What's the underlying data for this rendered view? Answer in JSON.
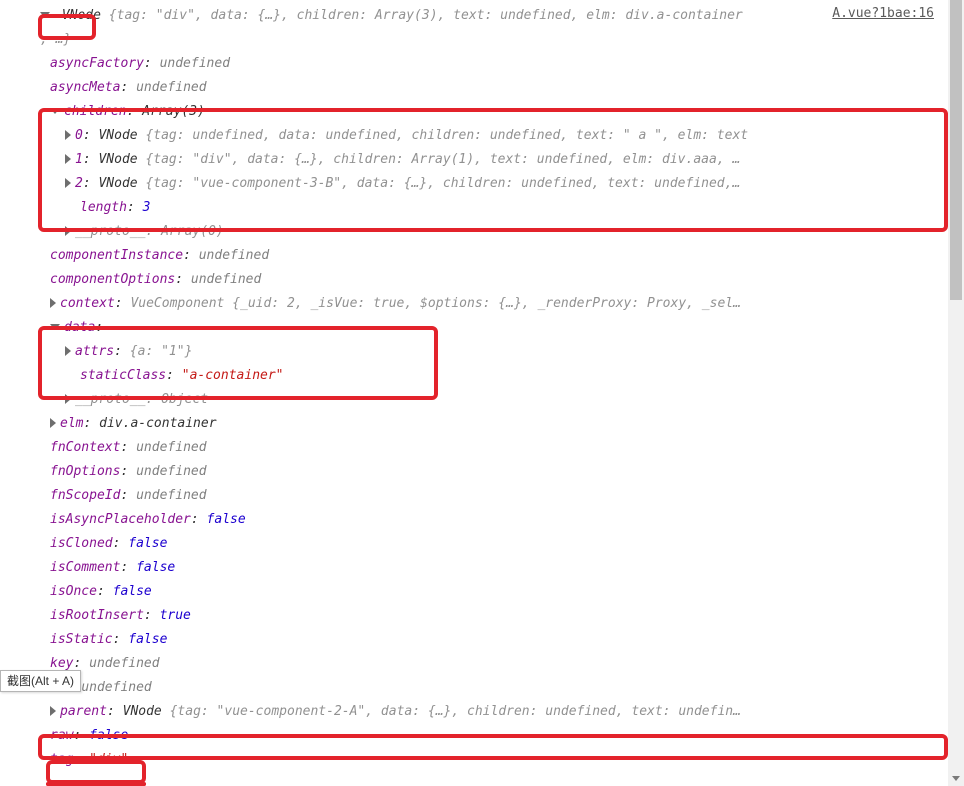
{
  "source_link": "A.vue?1bae:16",
  "tooltip": "截图(Alt + A)",
  "root": {
    "type": "VNode",
    "summary_open": "{",
    "summary_props": "tag: \"div\", data: {…}, children: Array(3), text: undefined, elm: div.a-container",
    "summary_close": ", …}"
  },
  "props": {
    "asyncFactory": {
      "k": "asyncFactory",
      "v": "undefined"
    },
    "asyncMeta": {
      "k": "asyncMeta",
      "v": "undefined"
    },
    "children": {
      "k": "children",
      "v": "Array(3)",
      "items": [
        {
          "idx": "0",
          "type": "VNode",
          "summary": "{tag: undefined, data: undefined, children: undefined, text: \" a \", elm: text"
        },
        {
          "idx": "1",
          "type": "VNode",
          "summary": "{tag: \"div\", data: {…}, children: Array(1), text: undefined, elm: div.aaa, …"
        },
        {
          "idx": "2",
          "type": "VNode",
          "summary": "{tag: \"vue-component-3-B\", data: {…}, children: undefined, text: undefined,…"
        }
      ],
      "length_k": "length",
      "length_v": "3",
      "proto_k": "__proto__",
      "proto_v": "Array(0)"
    },
    "componentInstance": {
      "k": "componentInstance",
      "v": "undefined"
    },
    "componentOptions": {
      "k": "componentOptions",
      "v": "undefined"
    },
    "context": {
      "k": "context",
      "v": "VueComponent {_uid: 2, _isVue: true, $options: {…}, _renderProxy: Proxy, _sel…"
    },
    "data": {
      "k": "data",
      "attrs_k": "attrs",
      "attrs_v": "{a: \"1\"}",
      "staticClass_k": "staticClass",
      "staticClass_v": "\"a-container\"",
      "proto_k": "__proto__",
      "proto_v": "Object"
    },
    "elm": {
      "k": "elm",
      "v": "div.a-container"
    },
    "fnContext": {
      "k": "fnContext",
      "v": "undefined"
    },
    "fnOptions": {
      "k": "fnOptions",
      "v": "undefined"
    },
    "fnScopeId": {
      "k": "fnScopeId",
      "v": "undefined"
    },
    "isAsyncPlaceholder": {
      "k": "isAsyncPlaceholder",
      "v": "false"
    },
    "isCloned": {
      "k": "isCloned",
      "v": "false"
    },
    "isComment": {
      "k": "isComment",
      "v": "false"
    },
    "isOnce": {
      "k": "isOnce",
      "v": "false"
    },
    "isRootInsert": {
      "k": "isRootInsert",
      "v": "true"
    },
    "isStatic": {
      "k": "isStatic",
      "v": "false"
    },
    "key": {
      "k": "key",
      "v": "undefined"
    },
    "ns": {
      "k": "ns",
      "v": "undefined"
    },
    "parent": {
      "k": "parent",
      "type": "VNode",
      "summary": "{tag: \"vue-component-2-A\", data: {…}, children: undefined, text: undefin…"
    },
    "raw": {
      "k": "raw",
      "v": "false"
    },
    "tag": {
      "k": "tag",
      "v": "\"div\""
    }
  }
}
